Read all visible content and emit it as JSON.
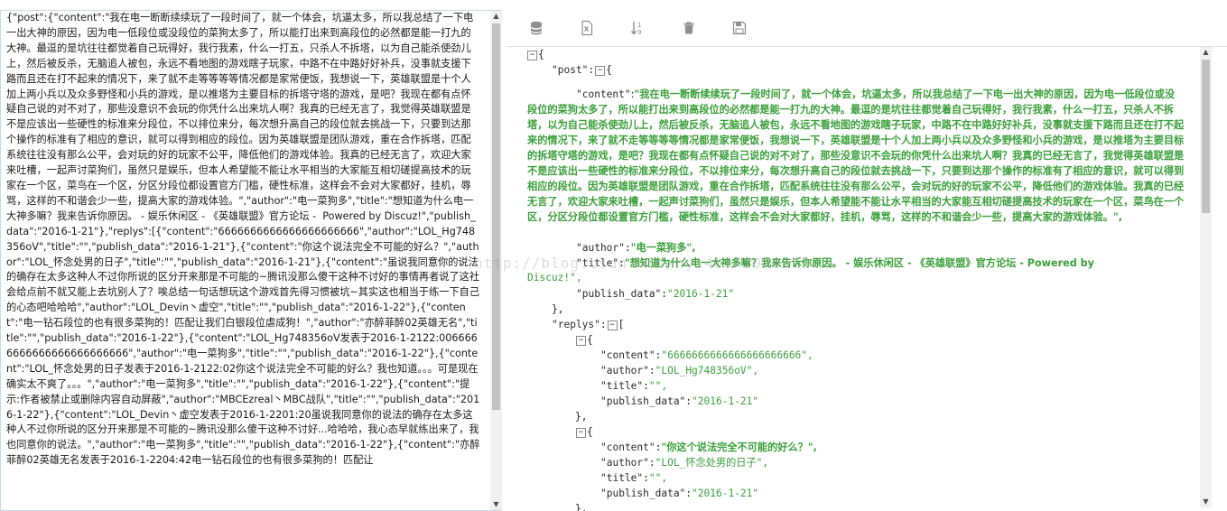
{
  "raw_text": "{\"post\":{\"content\":\"我在电一断断续续玩了一段时间了，就一个体会，坑逼太多，所以我总结了一下电一出大神的原因，因为电一低段位或没段位的菜狗太多了，所以能打出来到高段位的必然都是能一打九的大神。最逗的是坑往往都觉着自己玩得好，我行我素，什么一打五，只杀人不拆塔，以为自己能杀使劲儿上，然后被反杀，无脑追人被包，永远不看地图的游戏瞎子玩家，中路不在中路好好补兵，没事就支援下路而且还在打不起来的情况下，来了就不走等等等等情况都是家常便饭，我想说一下，英雄联盟是十个人加上两小兵以及众多野怪和小兵的游戏，是以推塔为主要目标的拆塔守塔的游戏，是吧？我现在都有点怀疑自己说的对不对了，那些没意识不会玩的你凭什么出来坑人啊？我真的已经无言了，我觉得英雄联盟是不是应该出一些硬性的标准来分段位，不以排位来分，每次想升高自己的段位就去挑战一下，只要到达那个操作的标准有了相应的意识，就可以得到相应的段位。因为英雄联盟是团队游戏，重在合作拆塔，匹配系统往往没有那么公平，会对玩的好的玩家不公平，降低他们的游戏体验。我真的已经无言了，欢迎大家来吐槽，一起声讨菜狗们，虽然只是娱乐，但本人希望能不能让水平相当的大家能互相切磋提高技术的玩家在一个区，菜鸟在一个区，分区分段位都设置官方门槛，硬性标准，这样会不会对大家都好，挂机，辱骂，这样的不和谐会少一些，提高大家的游戏体验。\",\"author\":\"电一菜狗多\",\"title\":\"想知道为什么电一大神多嘛？我来告诉你原因。 - 娱乐休闲区 - 《英雄联盟》官方论坛 -  Powered by Discuz!\",\"publish_data\":\"2016-1-21\"},\"replys\":[{\"content\":\"6666666666666666666666\",\"author\":\"LOL_Hg748356oV\",\"title\":\"\",\"publish_data\":\"2016-1-21\"},{\"content\":\"你这个说法完全不可能的好么？\",\"author\":\"LOL_怀念处男的日子\",\"title\":\"\",\"publish_data\":\"2016-1-21\"},{\"content\":\"虽说我同意你的说法的确存在太多这种人不过你所说的区分开来那是不可能的~腾讯没那么傻干这种不讨好的事情再者说了这社会给点前不就又能上去坑别人了？唉总结一句话想玩这个游戏首先得习惯被坑~其实这也相当于练一下自己的心态吧哈哈哈\",\"author\":\"LOL_Devin丶虚空\",\"title\":\"\",\"publish_data\":\"2016-1-22\"},{\"content\":\"电一钻石段位的也有很多菜狗的！匹配让我们白银段位虐成狗！\",\"author\":\"亦醉菲醉02英雄无名\",\"title\":\"\",\"publish_data\":\"2016-1-22\"},{\"content\":\"LOL_Hg748356oV发表于2016-1-2122:0066666666666666666666666\",\"author\":\"电一菜狗多\",\"title\":\"\",\"publish_data\":\"2016-1-22\"},{\"content\":\"LOL_怀念处男的日子发表于2016-1-2122:02你这个说法完全不可能的好么？我也知道。。。可是现在确实太不爽了。。。\",\"author\":\"电一菜狗多\",\"title\":\"\",\"publish_data\":\"2016-1-22\"},{\"content\":\"提示:作者被禁止或删除内容自动屏蔽\",\"author\":\"MBCEzreal丶MBC战队\",\"title\":\"\",\"publish_data\":\"2016-1-22\"},{\"content\":\"LOL_Devin丶虚空发表于2016-1-2201:20虽说我同意你的说法的确存在太多这种人不过你所说的区分开来那是不可能的~腾讯没那么傻干这种不讨好...哈哈哈，我心态早就练出来了，我也同意你的说法。\",\"author\":\"电一菜狗多\",\"title\":\"\",\"publish_data\":\"2016-1-22\"},{\"content\":\"亦醉菲醉02英雄无名发表于2016-1-2204:42电一钻石段位的也有很多菜狗的！匹配让",
  "tree": {
    "post_key": "\"post\"",
    "content_key": "\"content\"",
    "content_value": "\"我在电一断断续续玩了一段时间了，就一个体会，坑逼太多，所以我总结了一下电一出大神的原因，因为电一低段位或没段位的菜狗太多了，所以能打出来到高段位的必然都是能一打九的大神。最逗的是坑往往都觉着自己玩得好，我行我素，什么一打五，只杀人不拆塔，以为自己能杀使劲儿上，然后被反杀，无脑追人被包，永远不看地图的游戏瞎子玩家，中路不在中路好好补兵，没事就支援下路而且还在打不起来的情况下，来了就不走等等等等情况都是家常便饭，我想说一下，英雄联盟是十个人加上两小兵以及众多野怪和小兵的游戏，是以推塔为主要目标的拆塔守塔的游戏，是吧？我现在都有点怀疑自己说的对不对了，那些没意识不会玩的你凭什么出来坑人啊？我真的已经无言了，我觉得英雄联盟是不是应该出一些硬性的标准来分段位，不以排位来分，每次想升高自己的段位就去挑战一下，只要到达那个操作的标准有了相应的意识，就可以得到相应的段位。因为英雄联盟是团队游戏，重在合作拆塔，匹配系统往往没有那么公平，会对玩的好的玩家不公平，降低他们的游戏体验。我真的已经无言了，欢迎大家来吐槽，一起声讨菜狗们，虽然只是娱乐，但本人希望能不能让水平相当的大家能互相切磋提高技术的玩家在一个区，菜鸟在一个区，分区分段位都设置官方门槛，硬性标准，这样会不会对大家都好，挂机，辱骂，这样的不和谐会少一些，提高大家的游戏体验。\",",
    "author_key": "\"author\"",
    "author_value": "\"电一菜狗多\",",
    "title_key": "\"title\"",
    "title_value": "\"想知道为什么电一大神多嘛？我来告诉你原因。 - 娱乐休闲区 - 《英雄联盟》官方论坛 - Powered by",
    "title_wrap": "Discuz!\",",
    "publish_key": "\"publish_data\"",
    "publish_value": "\"2016-1-21\"",
    "replys_key": "\"replys\"",
    "replies": [
      {
        "content": "\"6666666666666666666666\",",
        "author": "\"LOL_Hg748356oV\",",
        "title": "\"\",",
        "publish_data": "\"2016-1-21\""
      },
      {
        "content": "\"你这个说法完全不可能的好么？\",",
        "author": "\"LOL_怀念处男的日子\",",
        "title": "\"\",",
        "publish_data": "\"2016-1-21\""
      }
    ]
  },
  "watermark": "http://blog.csdn.net/hy1405430407",
  "colors": {
    "string": "#3ba03b",
    "border": "#c9d7e6",
    "icon": "#9a9a9a"
  },
  "toolbar_icons": [
    "database-icon",
    "excel-export-icon",
    "sort-icon",
    "trash-icon",
    "save-icon"
  ]
}
